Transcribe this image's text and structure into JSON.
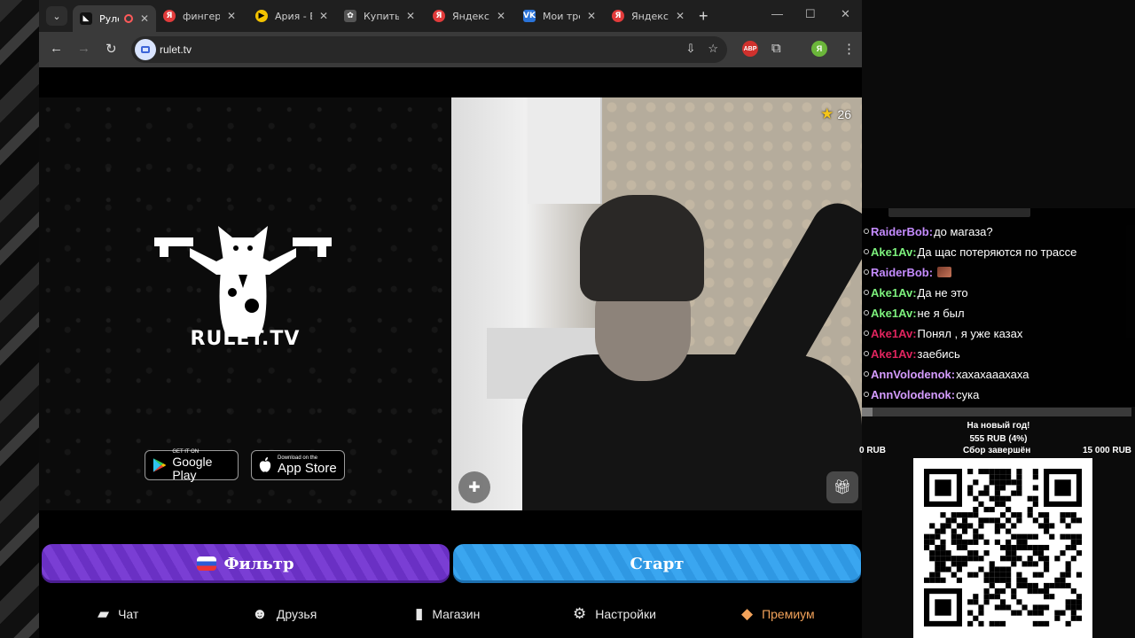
{
  "browser": {
    "tabs": [
      {
        "title": "Руле",
        "favicon": "rulet",
        "active": true,
        "recording": true
      },
      {
        "title": "фингер",
        "favicon": "yandex"
      },
      {
        "title": "Ария - Е",
        "favicon": "play"
      },
      {
        "title": "Купить",
        "favicon": "market"
      },
      {
        "title": "Яндекс",
        "favicon": "yandex"
      },
      {
        "title": "Мои тре",
        "favicon": "vk"
      },
      {
        "title": "Яндекс",
        "favicon": "yandex"
      }
    ],
    "url": "rulet.tv",
    "extensions": {
      "abp": "ABP",
      "profile": "Я"
    }
  },
  "site": {
    "logo_text": "RULET.TV",
    "google_play": {
      "small": "GET IT ON",
      "big": "Google Play"
    },
    "app_store": {
      "small": "Download on the",
      "big": "App Store"
    },
    "star_count": "26",
    "filter_label": "Фильтр",
    "start_label": "Старт",
    "nav": [
      {
        "label": "Чат",
        "icon": "chat-icon"
      },
      {
        "label": "Друзья",
        "icon": "friends-icon"
      },
      {
        "label": "Магазин",
        "icon": "shop-bag-icon"
      },
      {
        "label": "Настройки",
        "icon": "gear-icon"
      },
      {
        "label": "Премиум",
        "icon": "premium-tag-icon"
      }
    ]
  },
  "chat": {
    "messages": [
      {
        "nick": "RaiderBob:",
        "text": "до магаза?",
        "color": "#c58cff"
      },
      {
        "nick": "Ake1Av:",
        "text": "Да щас потеряются по трассе",
        "color": "#7cf07c"
      },
      {
        "nick": "RaiderBob:",
        "text": "",
        "color": "#c58cff",
        "emote": true
      },
      {
        "nick": "Ake1Av:",
        "text": "Да не это",
        "color": "#7cf07c"
      },
      {
        "nick": "Ake1Av:",
        "text": "не я был",
        "color": "#7cf07c"
      },
      {
        "nick": "Ake1Av:",
        "text": "Понял , я уже казах",
        "color": "#e0245e"
      },
      {
        "nick": "Ake1Av:",
        "text": "заебись",
        "color": "#e0245e"
      },
      {
        "nick": "AnnVolodenok:",
        "text": "хахахааахаха",
        "color": "#d59cff"
      },
      {
        "nick": "AnnVolodenok:",
        "text": "сука",
        "color": "#d59cff"
      }
    ]
  },
  "donation_goal": {
    "title": "На новый год!",
    "amount": "555 RUB (4%)",
    "progress": 0.04,
    "min": "0 RUB",
    "status": "Сбор завершён",
    "max": "15 000 RUB"
  }
}
